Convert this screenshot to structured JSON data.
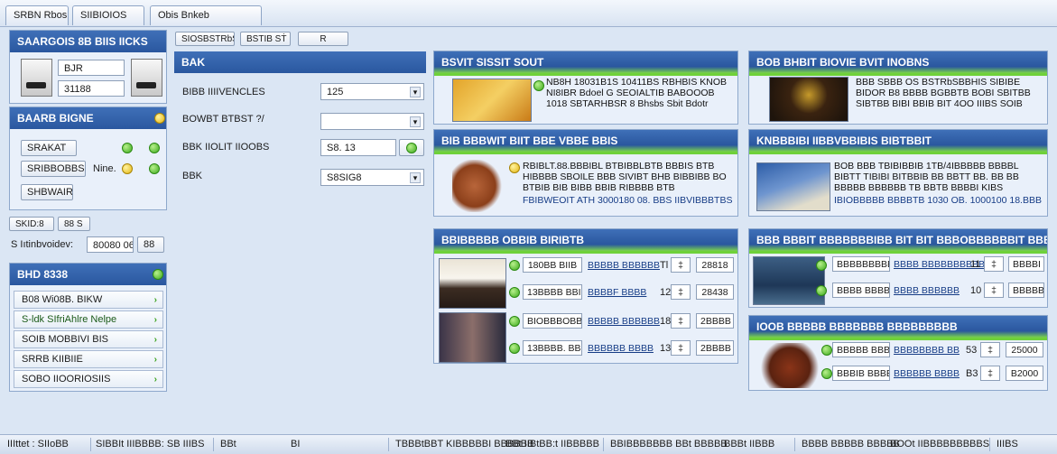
{
  "tabs": [
    "SRBN Rbos",
    "SIIBIOIOS",
    "Obis   Bnkeb"
  ],
  "left": {
    "profile_title": "SAARGOIS 8B BIIS IICKS",
    "field1": "BJR",
    "field2": "31188",
    "settings_title": "BAARB BIGNE",
    "btn1": "SRAKAT",
    "btn2": "SRIBBOBBS",
    "btn3": "SHBWAIRS",
    "inline_label": "Nine.",
    "mini_btn1": "SKID:8",
    "mini_btn2": "88 S",
    "search_label": "S Iıtinbvoidev:",
    "search_value": "80080 06",
    "search_btn": "88",
    "list_title": "BHD 8338",
    "list_items": [
      "B08 Wi08B. BIKW",
      "S-ldk SIfriAhlre Nelpe",
      "SOIB MOBBIVI BIS",
      "SRRB KIIBIIE",
      "SOBO IIOORIOSIIS"
    ]
  },
  "toolbar": {
    "btn1": "SIOSBSTRbSIB",
    "btn2": "BSTIB SṪ",
    "btn3": "R"
  },
  "form": {
    "title": "BAK",
    "rows": [
      {
        "label": "BIBB IIIIVENCLES",
        "value": "125"
      },
      {
        "label": "BOWBT BTBST ?/",
        "value": ""
      },
      {
        "label": "BBK IIOLIT IIOOBS",
        "value": "S8. 13"
      },
      {
        "label": "BBK",
        "value": "S8SIG8"
      }
    ]
  },
  "cards": {
    "c1": {
      "title": "BSVIT SISSIT SOUT",
      "desc": "NB8H 18031B1S 10411BS RBHBIS KNOB NI8IBR Bdoel G SEOIALTIB BABOOOB 1018 SBTARHBSR 8 Bhsbs Sbit Bdotr"
    },
    "c2": {
      "title": "BOB BHBIT BIOVIE BVIT INOBNS",
      "desc": "BBB SBBB OS BSTRbSBBHIS SIBIBE BIDOR B8 BBBB BGBBTB BOBI SBITBB SIBTBB BIBI BBIB BIT 4OO IIIBS SOIB"
    },
    "c3": {
      "title": "BIB BBBWIT BIIT BBE VBBE BBIS",
      "desc": "RBIBLT.88.BBBIBL BTBIBBLBTB BBBIS BTB HIBBBB SBOILE BBB SIVIBT BHB BIBBIBB BO BTBIB BIB BIBB BBIB RIBBBB BTB",
      "meta": "FBIBWEOIT ATH    3000180 08. BBS IIBVIBBBTBS"
    },
    "c4": {
      "title": "KNBBBIBI IIBBVBBIBIS BIBTBBIT",
      "desc": "BOB BBB TBIBIBBIB 1TB/4IBBBBB BBBBL BIBTT TIBIBI BITBBIB BB BBTT BB. BB BB BBBBB BBBBBB TB BBTB BBBBI KIBS",
      "meta": "IBIOBBBBB  BBBBTB 1030 OB. 1000100 18.BBB"
    },
    "c5": {
      "title": "BBIBBBBB OBBIB BIRIBTB",
      "rows": [
        {
          "name": "180BB BIIB",
          "brand": "BBBBB BBBBBB",
          "qty": "Tl",
          "price": "28818"
        },
        {
          "name": "13BBBB BBIB",
          "brand": "BBBBF BBBB",
          "qty": "12",
          "price": "28438"
        },
        {
          "name": "BIOBBBOBBB",
          "brand": "BBBBB BBBBBB",
          "qty": "18",
          "price": "2BBBB"
        },
        {
          "name": "13BBBB. BBB",
          "brand": "BBBBBB BBBB",
          "qty": "13",
          "price": "2BBBB"
        }
      ]
    },
    "c6": {
      "title": "BBB BBBIT BBBBBBBIBB BIT BIT BBBOBBBBBBIT BBBB",
      "rows": [
        {
          "name": "BBBBBBBBBB",
          "brand": "BBBB BBBBBBBBBB",
          "qty": "11",
          "price": "BBBBI"
        },
        {
          "name": "BBBB BBBB",
          "brand": "BBBB BBBBBB",
          "qty": "10",
          "price": "BBBBB"
        }
      ]
    },
    "c7": {
      "title": "IOOB BBBBB BBBBBBB BBBBBBBBB",
      "rows": [
        {
          "name": "BBBBB BBBB",
          "brand": "BBBBBBBB BB",
          "qty": "53",
          "price": "25000"
        },
        {
          "name": "BBBIB BBBB",
          "brand": "BBBBBB BBBB",
          "qty": "B3",
          "price": "B2000"
        }
      ]
    }
  },
  "status": [
    "IIIttet : SIIoBB",
    "SIBBIt IIIBBBB: SB IIIBS",
    "BBt",
    "BI",
    "TBBBtBBT KIBBBBBI BBBBBB",
    "BBt IIBtBB:t IIBBBBB",
    "BBIBBBBBBB BBt BBBBB",
    "BBBt IIBBB",
    "BBBB BBBBB BBBBB",
    "BOOt IIBBBBBBBBBS",
    "IIIBS"
  ]
}
